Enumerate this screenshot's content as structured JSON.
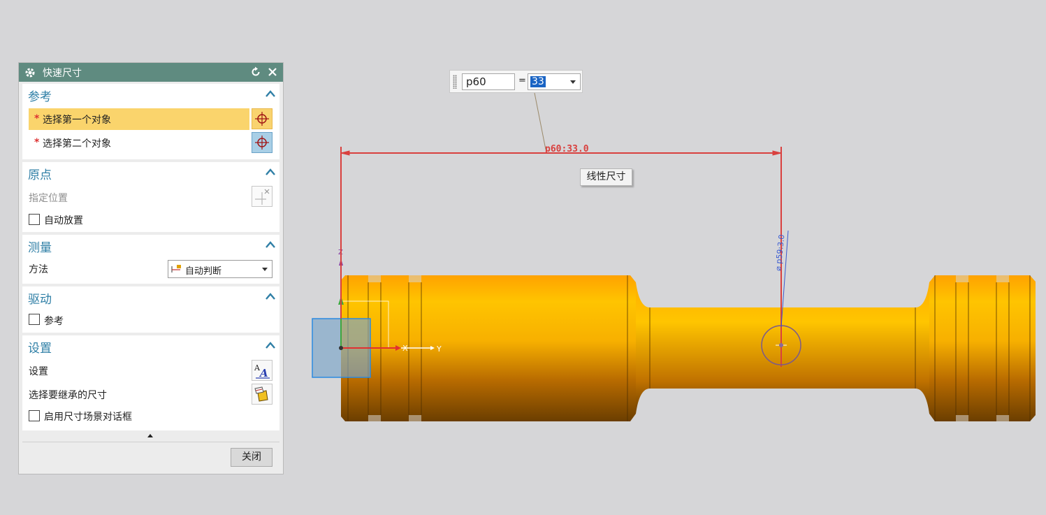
{
  "dialog": {
    "title": "快速尺寸",
    "sections": {
      "reference": {
        "title": "参考",
        "first_object": "选择第一个对象",
        "second_object": "选择第二个对象",
        "required_mark": "*"
      },
      "origin": {
        "title": "原点",
        "specify_location": "指定位置",
        "auto_place": "自动放置"
      },
      "measurement": {
        "title": "测量",
        "method_label": "方法",
        "method_value": "自动判断"
      },
      "driving": {
        "title": "驱动",
        "reference": "参考"
      },
      "settings": {
        "title": "设置",
        "settings_label": "设置",
        "inherit_label": "选择要继承的尺寸",
        "enable_dialog": "启用尺寸场景对话框"
      }
    },
    "close_label": "关闭"
  },
  "viewport": {
    "expression_name": "p60",
    "equals": "=",
    "expression_value": "33",
    "dim_label": "p60:33.0",
    "dim_label_small": "⌀ p59:3.0",
    "tooltip": "线性尺寸",
    "axis_x": "X",
    "axis_y": "Y",
    "axis_z": "Z"
  },
  "colors": {
    "title_bar": "#5f8b80",
    "section_title": "#2f7fa6",
    "highlight": "#fad46c",
    "part_orange": "#f5a600",
    "dimension_red": "#d9403e"
  }
}
